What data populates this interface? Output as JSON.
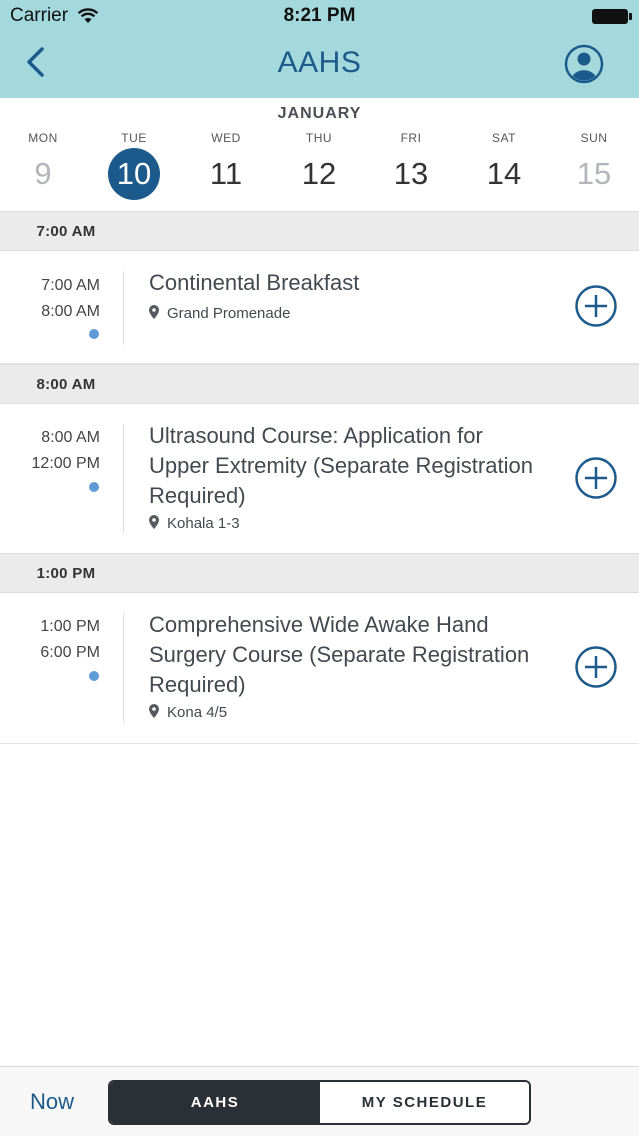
{
  "status_bar": {
    "carrier": "Carrier",
    "time": "8:21 PM"
  },
  "nav": {
    "title": "AAHS",
    "back_icon": "chevron-left-icon",
    "profile_icon": "user-circle-icon"
  },
  "calendar": {
    "month": "JANUARY",
    "days": [
      {
        "dow": "MON",
        "num": "9",
        "state": "muted"
      },
      {
        "dow": "TUE",
        "num": "10",
        "state": "selected"
      },
      {
        "dow": "WED",
        "num": "11",
        "state": "normal"
      },
      {
        "dow": "THU",
        "num": "12",
        "state": "normal"
      },
      {
        "dow": "FRI",
        "num": "13",
        "state": "normal"
      },
      {
        "dow": "SAT",
        "num": "14",
        "state": "normal"
      },
      {
        "dow": "SUN",
        "num": "15",
        "state": "muted"
      }
    ]
  },
  "sections": [
    {
      "time": "7:00 AM",
      "sessions": [
        {
          "start": "7:00 AM",
          "end": "8:00 AM",
          "title": "Continental Breakfast",
          "location": "Grand Promenade"
        }
      ]
    },
    {
      "time": "8:00 AM",
      "sessions": [
        {
          "start": "8:00 AM",
          "end": "12:00 PM",
          "title": "Ultrasound Course: Application for Upper Extremity (Separate Registration Required)",
          "location": "Kohala 1-3"
        }
      ]
    },
    {
      "time": "1:00 PM",
      "sessions": [
        {
          "start": "1:00 PM",
          "end": "6:00 PM",
          "title": "Comprehensive Wide Awake Hand Surgery Course (Separate Registration Required)",
          "location": "Kona 4/5"
        }
      ]
    }
  ],
  "bottom_bar": {
    "now_label": "Now",
    "segment_active": "AAHS",
    "segment_inactive": "MY SCHEDULE"
  },
  "colors": {
    "header_bg": "#a3d8dc",
    "primary": "#1d5a8c",
    "dot": "#5e9bd6",
    "section_bg": "#ebebeb"
  }
}
